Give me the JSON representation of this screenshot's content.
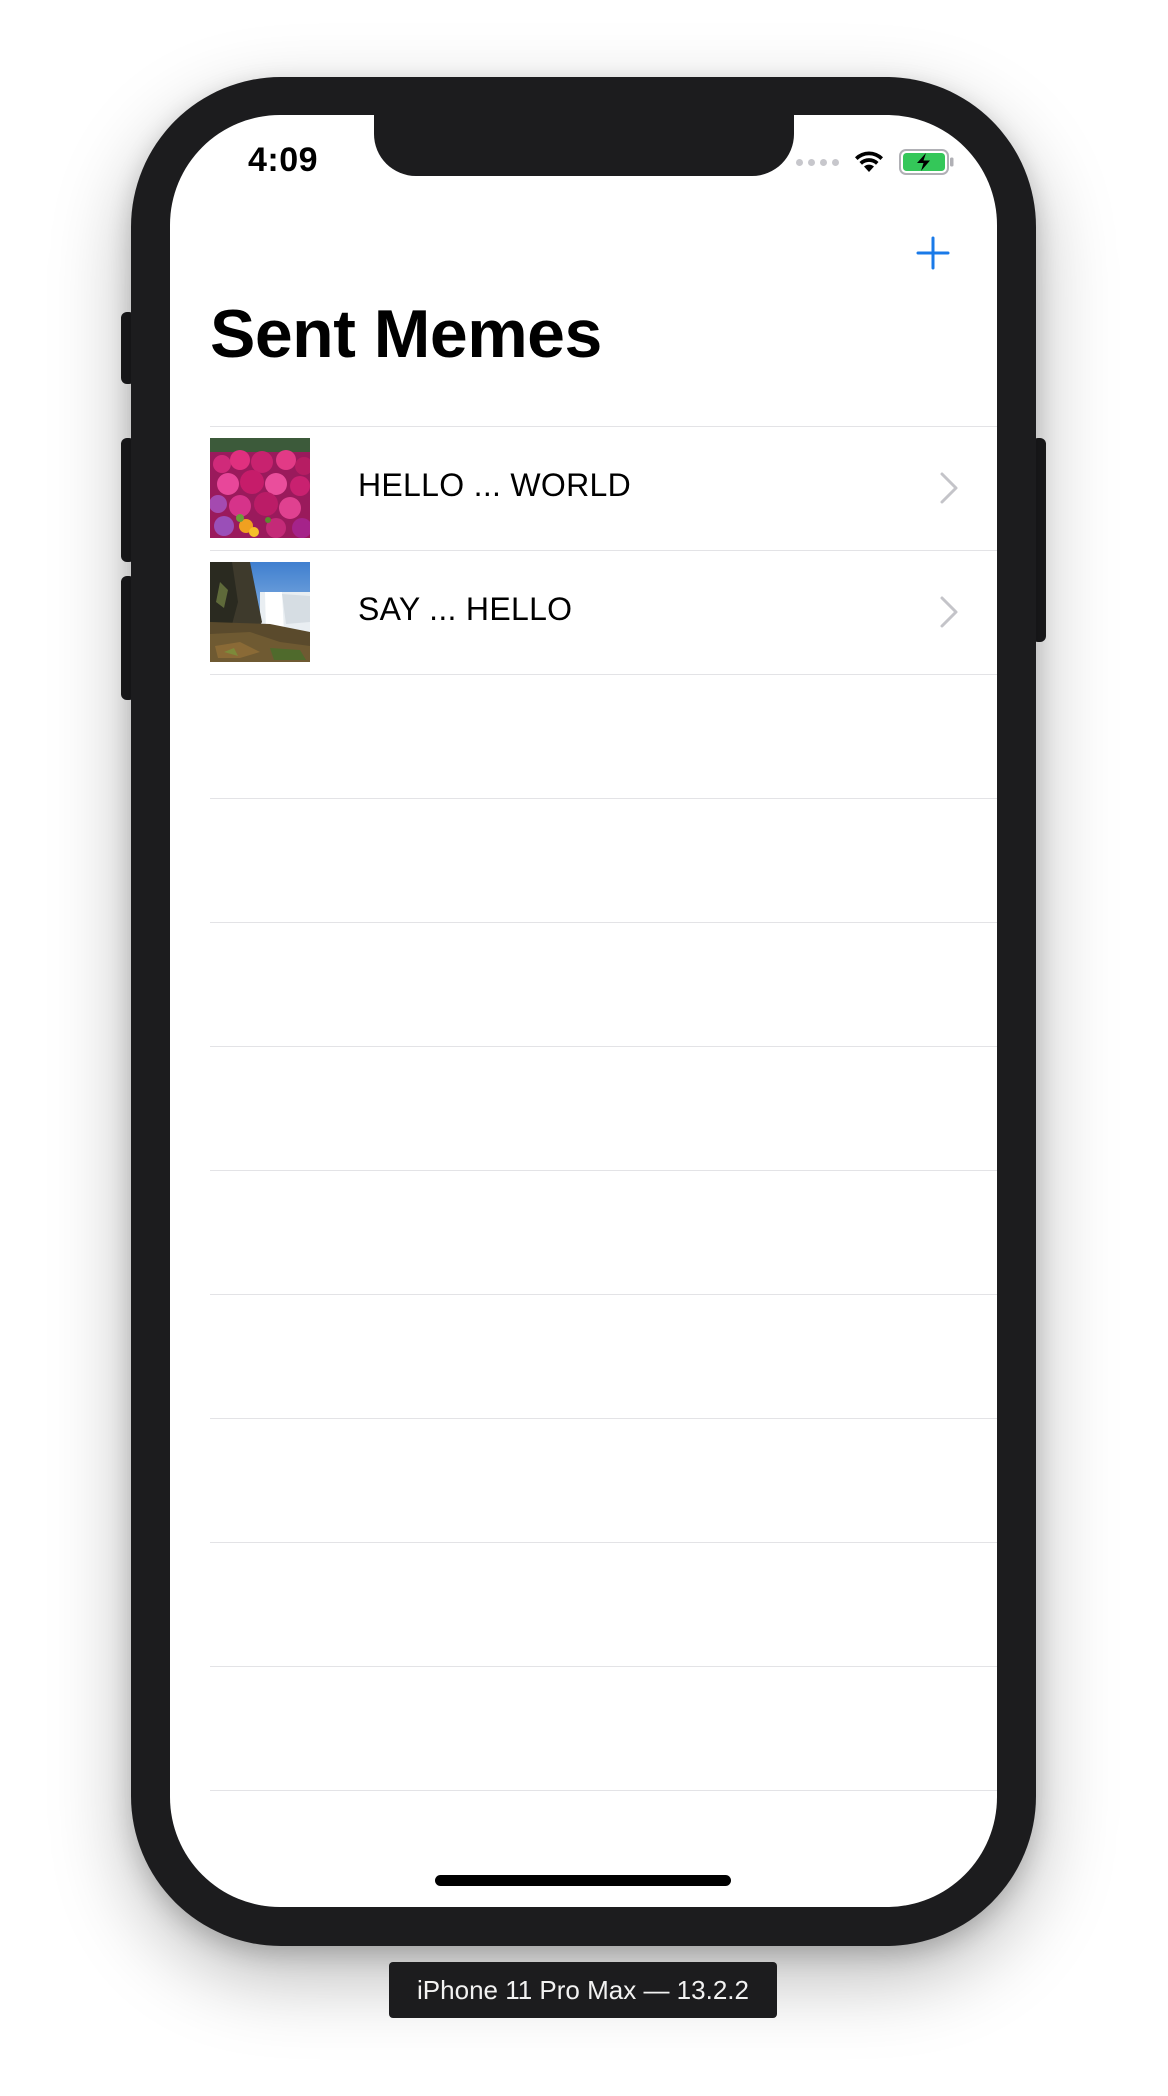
{
  "status_bar": {
    "time": "4:09",
    "signal_icon": "cellular-dots-icon",
    "wifi_icon": "wifi-icon",
    "battery_icon": "battery-charging-icon",
    "battery_color": "#34c759"
  },
  "nav_bar": {
    "title": "Sent Memes",
    "add_icon": "plus-icon",
    "tint_color": "#1a7ae8"
  },
  "table": {
    "rows": [
      {
        "label": "HELLO ... WORLD",
        "thumbnail": "flowers-thumbnail"
      },
      {
        "label": "SAY ... HELLO",
        "thumbnail": "waterfall-thumbnail"
      }
    ],
    "empty_rows": 9,
    "separator_color": "#e3e3e6",
    "chevron_icon": "chevron-right-icon"
  },
  "device_label": "iPhone 11 Pro Max — 13.2.2"
}
